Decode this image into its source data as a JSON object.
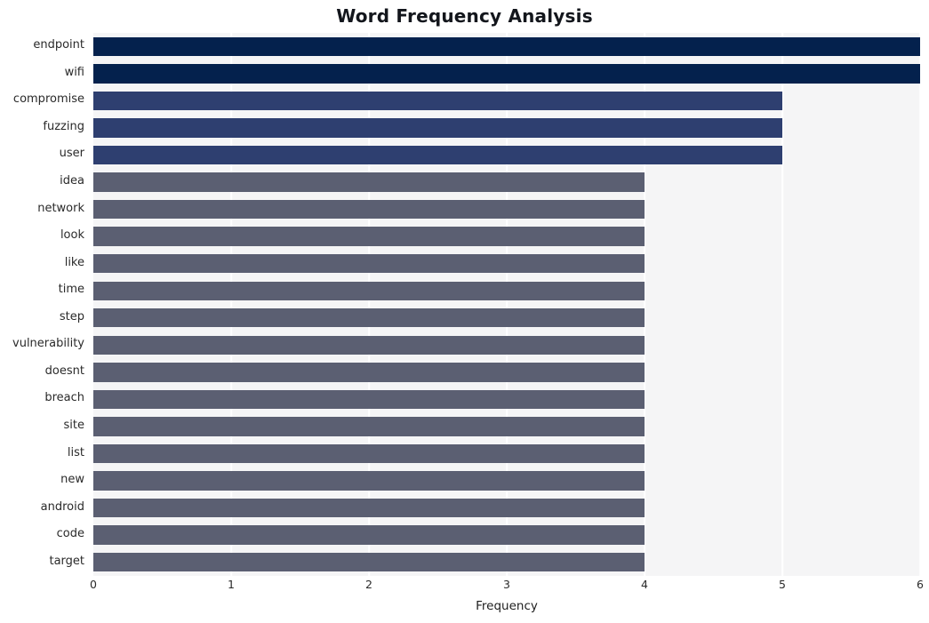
{
  "chart_data": {
    "type": "bar",
    "orientation": "horizontal",
    "title": "Word Frequency Analysis",
    "xlabel": "Frequency",
    "ylabel": "",
    "xlim": [
      0,
      6
    ],
    "xticks": [
      0,
      1,
      2,
      3,
      4,
      5,
      6
    ],
    "xtick_labels": [
      "0",
      "1",
      "2",
      "3",
      "4",
      "5",
      "6"
    ],
    "grid": true,
    "grid_axis": "x",
    "legend": false,
    "categories": [
      "endpoint",
      "wifi",
      "compromise",
      "fuzzing",
      "user",
      "idea",
      "network",
      "look",
      "like",
      "time",
      "step",
      "vulnerability",
      "doesnt",
      "breach",
      "site",
      "list",
      "new",
      "android",
      "code",
      "target"
    ],
    "values": [
      6,
      6,
      5,
      5,
      5,
      4,
      4,
      4,
      4,
      4,
      4,
      4,
      4,
      4,
      4,
      4,
      4,
      4,
      4,
      4
    ],
    "bar_colors": [
      "#04214d",
      "#04214d",
      "#2e3f70",
      "#2e3f70",
      "#2e3f70",
      "#5b5f72",
      "#5b5f72",
      "#5b5f72",
      "#5b5f72",
      "#5b5f72",
      "#5b5f72",
      "#5b5f72",
      "#5b5f72",
      "#5b5f72",
      "#5b5f72",
      "#5b5f72",
      "#5b5f72",
      "#5b5f72",
      "#5b5f72",
      "#5b5f72"
    ]
  },
  "style": {
    "plot_background": "#f5f5f6",
    "figure_background": "#ffffff",
    "gridline_color": "#ffffff",
    "text_color": "#2a2a2a",
    "title_color": "#13161c"
  }
}
